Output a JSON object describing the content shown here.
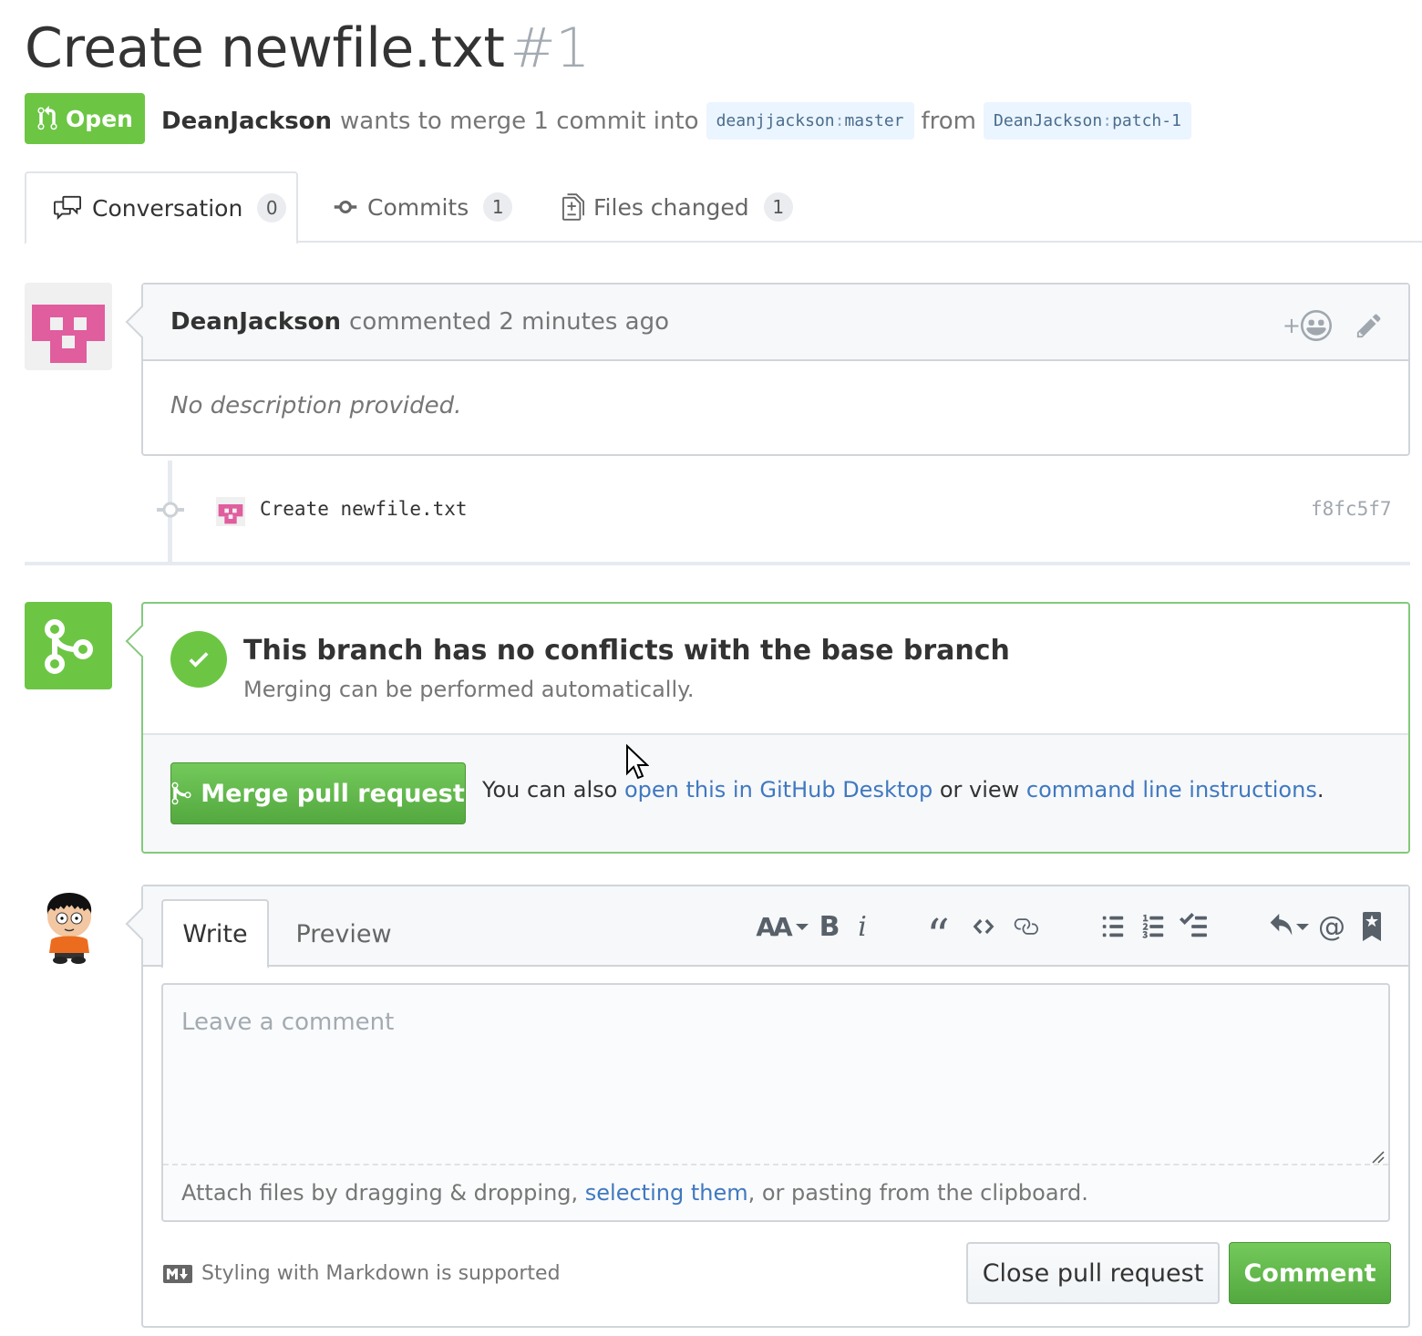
{
  "pr": {
    "title": "Create newfile.txt",
    "number": "#1",
    "state": "Open",
    "author": "DeanJackson",
    "merge_text_1": "wants to merge 1 commit into",
    "base_user": "deanjjackson",
    "base_branch": "master",
    "merge_text_2": "from",
    "head_user": "DeanJackson",
    "head_branch": "patch-1",
    "branch_sep": ":"
  },
  "tabs": [
    {
      "label": "Conversation",
      "count": "0"
    },
    {
      "label": "Commits",
      "count": "1"
    },
    {
      "label": "Files changed",
      "count": "1"
    }
  ],
  "comment": {
    "author": "DeanJackson",
    "meta": "commented 2 minutes ago",
    "body": "No description provided.",
    "reaction_plus": "+"
  },
  "commit": {
    "message": "Create newfile.txt",
    "sha": "f8fc5f7"
  },
  "merge": {
    "heading": "This branch has no conflicts with the base branch",
    "subtext": "Merging can be performed automatically.",
    "button_label": "Merge pull request",
    "alt_prefix": "You can also",
    "alt_link1": "open this in GitHub Desktop",
    "alt_mid": "or view",
    "alt_link2": "command line instructions",
    "alt_suffix": "."
  },
  "form": {
    "tab_write": "Write",
    "tab_preview": "Preview",
    "placeholder": "Leave a comment",
    "attach_prefix": "Attach files by dragging & dropping,",
    "attach_link": "selecting them",
    "attach_suffix": ", or pasting from the clipboard.",
    "markdown_note": "Styling with Markdown is supported",
    "close_label": "Close pull request",
    "comment_label": "Comment",
    "toolbar": {
      "header": "AA",
      "bold": "B",
      "italic": "i",
      "quote": "“",
      "mention": "@"
    }
  },
  "colors": {
    "green": "#6cc644",
    "link": "#4078c0",
    "identicon": "#e05d9e"
  },
  "icons": [
    "pr-open-icon",
    "comment-discussion-icon",
    "commit-icon",
    "diff-icon",
    "smiley-icon",
    "pencil-icon",
    "check-icon",
    "git-merge-icon",
    "link-icon",
    "list-unordered-icon",
    "list-ordered-icon",
    "tasklist-icon",
    "reply-icon",
    "bookmark-icon",
    "markdown-icon",
    "cursor-icon"
  ]
}
